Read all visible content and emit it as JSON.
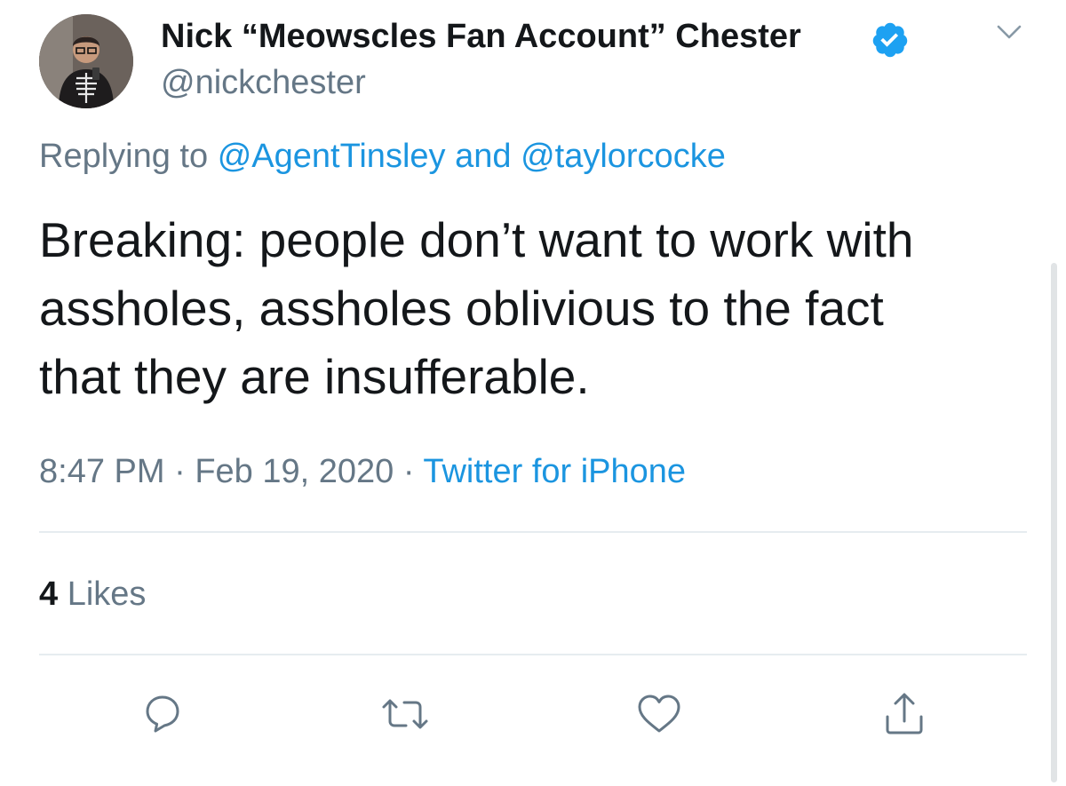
{
  "author": {
    "display_name": "Nick “Meowscles Fan Account” Chester",
    "handle": "@nickchester"
  },
  "icons": {
    "verified": "verified-badge-icon",
    "menu": "chevron-down-icon",
    "reply": "reply-icon",
    "retweet": "retweet-icon",
    "like": "heart-icon",
    "share": "share-icon"
  },
  "reply_context": {
    "prefix": "Replying to",
    "mention_1": "@AgentTinsley",
    "conjunction": "and",
    "mention_2": "@taylorcocke"
  },
  "tweet": {
    "lines": [
      "Breaking: people don’t want to work with",
      "assholes, assholes oblivious to the fact",
      "that they are insufferable."
    ]
  },
  "meta": {
    "time": "8:47 PM",
    "separator": "·",
    "date": "Feb 19, 2020",
    "source": "Twitter for iPhone"
  },
  "stats": {
    "likes_count": "4",
    "likes_label": "Likes"
  },
  "colors": {
    "link": "#1b95e0",
    "secondary_text": "#657786",
    "primary_text": "#14171a",
    "divider": "#e6ecf0",
    "verified": "#1da1f2"
  }
}
